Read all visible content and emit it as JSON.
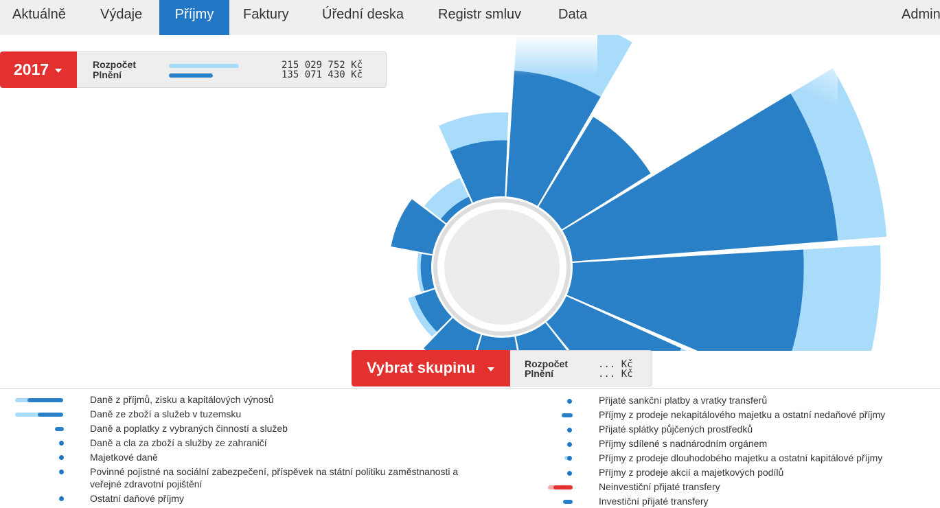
{
  "nav": {
    "items": [
      "Aktuálně",
      "Výdaje",
      "Příjmy",
      "Faktury",
      "Úřední deska",
      "Registr smluv",
      "Data",
      "Admin"
    ],
    "active_index": 2
  },
  "summary": {
    "year": "2017",
    "budget_label": "Rozpočet",
    "actual_label": "Plnění",
    "budget_amount": "215 029 752 Kč",
    "actual_amount": "135 071 430 Kč",
    "actual_fraction": 0.63
  },
  "group": {
    "button_label": "Vybrat skupinu",
    "budget_label": "Rozpočet",
    "actual_label": "Plnění",
    "budget_amount": "... Kč",
    "actual_amount": "... Kč"
  },
  "chart_data": {
    "type": "polar-bar",
    "segments": [
      {
        "budget": 27,
        "actual": 18
      },
      {
        "budget": 15,
        "actual": 15
      },
      {
        "budget": 45,
        "actual": 38
      },
      {
        "budget": 44,
        "actual": 33
      },
      {
        "budget": 22,
        "actual": 18
      },
      {
        "budget": 8,
        "actual": 8
      },
      {
        "budget": 13,
        "actual": 11
      },
      {
        "budget": 6,
        "actual": 6
      },
      {
        "budget": 4,
        "actual": 3
      },
      {
        "budget": 2,
        "actual": 1.5
      },
      {
        "budget": 6,
        "actual": 6
      },
      {
        "budget": 4,
        "actual": 1
      },
      {
        "budget": 12,
        "actual": 8
      }
    ],
    "colors": {
      "budget": "#a9dbfa",
      "actual": "#2a80c6",
      "ring": "#dddddd"
    }
  },
  "legend": {
    "left": [
      {
        "label": "Daně z příjmů, zisku a kapitálových výnosů",
        "kind": "bar",
        "budget": 0.95,
        "actual": 0.7
      },
      {
        "label": "Daně ze zboží a služeb v tuzemsku",
        "kind": "bar",
        "budget": 0.95,
        "actual": 0.55
      },
      {
        "label": "Daně a poplatky z vybraných činností a služeb",
        "kind": "small",
        "budget": 0.2,
        "actual": 0.15
      },
      {
        "label": "Daně a cla za zboží a služby ze zahraničí",
        "kind": "dot"
      },
      {
        "label": "Majetkové daně",
        "kind": "dot"
      },
      {
        "label": "Povinné pojistné na sociální zabezpečení, příspěvek na státní politiku zaměstnanosti a",
        "label2": "veřejné zdravotní pojištění",
        "kind": "dot"
      },
      {
        "label": "Ostatní daňové příjmy",
        "kind": "dot"
      }
    ],
    "right": [
      {
        "label": "Přijaté sankční platby a vratky transferů",
        "kind": "dot"
      },
      {
        "label": "Příjmy z prodeje nekapitálového majetku a ostatní nedaňové příjmy",
        "kind": "small"
      },
      {
        "label": "Přijaté splátky půjčených prostředků",
        "kind": "dot"
      },
      {
        "label": "Příjmy sdílené s nadnárodním orgánem",
        "kind": "dot"
      },
      {
        "label": "Příjmy z prodeje dlouhodobého majetku a ostatní kapitálové příjmy",
        "kind": "dot2"
      },
      {
        "label": "Příjmy z prodeje akcií a majetkových podílů",
        "kind": "dot"
      },
      {
        "label": "Neinvestiční přijaté transfery",
        "kind": "red"
      },
      {
        "label": "Investiční přijaté transfery",
        "kind": "small"
      }
    ]
  }
}
